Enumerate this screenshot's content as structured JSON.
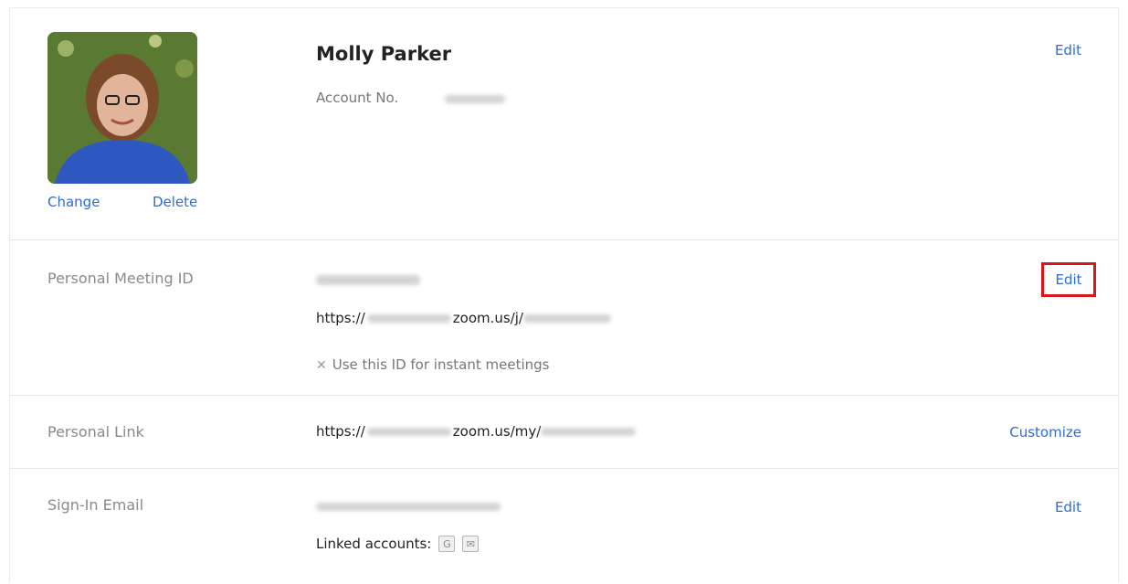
{
  "profile": {
    "name": "Molly Parker",
    "account_label": "Account No.",
    "change_label": "Change",
    "delete_label": "Delete",
    "edit_label": "Edit"
  },
  "pmi": {
    "label": "Personal Meeting ID",
    "url_prefix": "https://",
    "url_mid": "zoom.us/j/",
    "instant_text": "Use this ID for instant meetings",
    "edit_label": "Edit"
  },
  "personal_link": {
    "label": "Personal Link",
    "url_prefix": "https://",
    "url_mid": "zoom.us/my/",
    "customize_label": "Customize"
  },
  "email": {
    "label": "Sign-In Email",
    "linked_label": "Linked accounts:",
    "edit_label": "Edit"
  },
  "icons": [
    "close-icon",
    "google-icon",
    "mail-icon"
  ],
  "colors": {
    "link": "#2d6cd2",
    "highlight": "#d9161c"
  }
}
